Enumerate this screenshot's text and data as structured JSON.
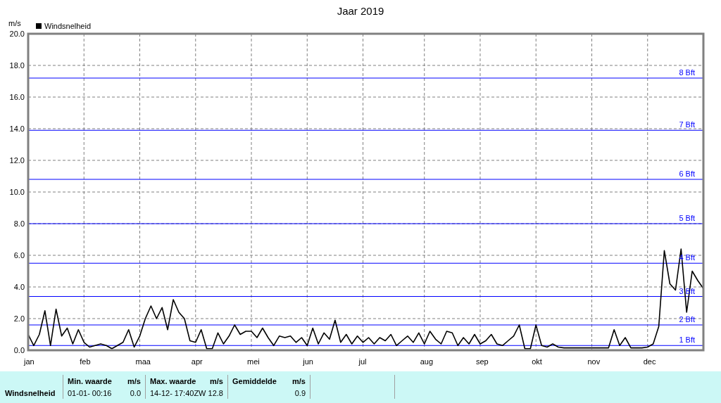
{
  "chart": {
    "chart_data": {
      "type": "line",
      "title": "Jaar 2019",
      "ylabel": "m/s",
      "categories": [
        "jan",
        null,
        null,
        null,
        null,
        null,
        null,
        null,
        null,
        null,
        "feb",
        null,
        null,
        null,
        null,
        null,
        null,
        null,
        null,
        null,
        "maa",
        null,
        null,
        null,
        null,
        null,
        null,
        null,
        null,
        null,
        "apr",
        null,
        null,
        null,
        null,
        null,
        null,
        null,
        null,
        null,
        "mei",
        null,
        null,
        null,
        null,
        null,
        null,
        null,
        null,
        null,
        "jun",
        null,
        null,
        null,
        null,
        null,
        null,
        null,
        null,
        null,
        "jul",
        null,
        null,
        null,
        null,
        null,
        null,
        null,
        null,
        null,
        null,
        "aug",
        null,
        null,
        null,
        null,
        null,
        null,
        null,
        null,
        null,
        "sep",
        null,
        null,
        null,
        null,
        null,
        null,
        null,
        null,
        null,
        "okt",
        null,
        null,
        null,
        null,
        null,
        null,
        null,
        null,
        null,
        "nov",
        null,
        null,
        null,
        null,
        null,
        null,
        null,
        null,
        null,
        "dec",
        null,
        null,
        null,
        null,
        null,
        null,
        null,
        null,
        null,
        null
      ],
      "series": [
        {
          "name": "Windsnelheid",
          "color": "#000000",
          "values": [
            1.0,
            0.3,
            1.0,
            2.5,
            0.3,
            2.6,
            0.9,
            1.4,
            0.4,
            1.3,
            0.5,
            0.2,
            0.3,
            0.4,
            0.3,
            0.1,
            0.3,
            0.5,
            1.3,
            0.2,
            0.9,
            2.0,
            2.8,
            2.0,
            2.7,
            1.3,
            3.2,
            2.4,
            2.0,
            0.6,
            0.5,
            1.3,
            0.1,
            0.1,
            1.1,
            0.4,
            0.9,
            1.6,
            1.0,
            1.2,
            1.2,
            0.8,
            1.4,
            0.8,
            0.3,
            0.9,
            0.8,
            0.9,
            0.5,
            0.8,
            0.3,
            1.4,
            0.4,
            1.1,
            0.7,
            1.9,
            0.5,
            1.0,
            0.4,
            0.9,
            0.5,
            0.8,
            0.4,
            0.8,
            0.6,
            1.0,
            0.3,
            0.6,
            0.9,
            0.5,
            1.1,
            0.4,
            1.2,
            0.7,
            0.4,
            1.2,
            1.1,
            0.3,
            0.8,
            0.4,
            1.0,
            0.4,
            0.6,
            1.0,
            0.4,
            0.3,
            0.6,
            0.9,
            1.6,
            0.1,
            0.1,
            1.6,
            0.3,
            0.2,
            0.4,
            0.2,
            0.15,
            0.15,
            0.15,
            0.15,
            0.15,
            0.15,
            0.15,
            0.15,
            0.15,
            1.3,
            0.3,
            0.8,
            0.15,
            0.15,
            0.15,
            0.2,
            0.4,
            1.5,
            6.3,
            4.2,
            3.8,
            6.4,
            2.4,
            5.0,
            4.4,
            3.9
          ]
        }
      ],
      "ylim": [
        0,
        20
      ],
      "grid": true,
      "yticks": [
        {
          "value": 0,
          "label": "0.0"
        },
        {
          "value": 2,
          "label": "2.0"
        },
        {
          "value": 4,
          "label": "4.0"
        },
        {
          "value": 6,
          "label": "6.0"
        },
        {
          "value": 8,
          "label": "8.0"
        },
        {
          "value": 10,
          "label": "10.0"
        },
        {
          "value": 12,
          "label": "12.0"
        },
        {
          "value": 14,
          "label": "14.0"
        },
        {
          "value": 16,
          "label": "16.0"
        },
        {
          "value": 18,
          "label": "18.0"
        },
        {
          "value": 20,
          "label": "20.0"
        }
      ],
      "ref_lines": [
        {
          "axis": "y",
          "value": 0.3,
          "label": "1 Bft",
          "color": "#0000ff"
        },
        {
          "axis": "y",
          "value": 1.6,
          "label": "2 Bft",
          "color": "#0000ff"
        },
        {
          "axis": "y",
          "value": 3.4,
          "label": "3 Bft",
          "color": "#0000ff"
        },
        {
          "axis": "y",
          "value": 5.5,
          "label": "4 Bft",
          "color": "#0000ff"
        },
        {
          "axis": "y",
          "value": 8.0,
          "label": "5 Bft",
          "color": "#0000ff"
        },
        {
          "axis": "y",
          "value": 10.8,
          "label": "6 Bft",
          "color": "#0000ff"
        },
        {
          "axis": "y",
          "value": 13.9,
          "label": "7 Bft",
          "color": "#0000ff"
        },
        {
          "axis": "y",
          "value": 17.2,
          "label": "8 Bft",
          "color": "#0000ff"
        }
      ]
    }
  },
  "summary": {
    "columns": [
      {
        "label": "Min. waarde",
        "unit": "m/s"
      },
      {
        "label": "Max. waarde",
        "unit": "m/s"
      },
      {
        "label": "Gemiddelde",
        "unit": "m/s"
      }
    ],
    "rows": [
      {
        "label": "Windsnelheid",
        "cells": [
          {
            "time": "01-01- 00:16",
            "value": "0.0"
          },
          {
            "time": "14-12- 17:40ZW",
            "value": "12.8"
          },
          {
            "value": "0.9"
          }
        ]
      }
    ]
  }
}
